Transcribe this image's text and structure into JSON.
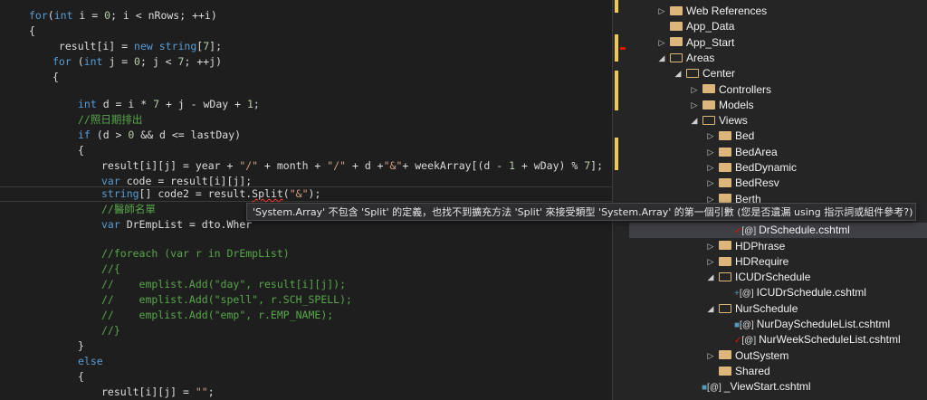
{
  "editor": {
    "lines": [
      {
        "segs": [
          [
            "kw",
            "for"
          ],
          [
            "",
            "("
          ],
          [
            "kw",
            "int"
          ],
          [
            "",
            " i = "
          ],
          [
            "num",
            "0"
          ],
          [
            "",
            "; i < nRows; ++i)"
          ]
        ]
      },
      {
        "segs": [
          [
            "",
            "{"
          ]
        ]
      },
      {
        "segs": [
          [
            "",
            " result[i] = "
          ],
          [
            "kw",
            "new"
          ],
          [
            "",
            " "
          ],
          [
            "kw",
            "string"
          ],
          [
            "",
            "["
          ],
          [
            "num",
            "7"
          ],
          [
            "",
            "];"
          ]
        ]
      },
      {
        "segs": [
          [
            "kw",
            "for"
          ],
          [
            "",
            " ("
          ],
          [
            "kw",
            "int"
          ],
          [
            "",
            " j = "
          ],
          [
            "num",
            "0"
          ],
          [
            "",
            "; j < "
          ],
          [
            "num",
            "7"
          ],
          [
            "",
            "; ++j)"
          ]
        ]
      },
      {
        "segs": [
          [
            "",
            "{"
          ]
        ]
      },
      {
        "segs": []
      },
      {
        "segs": [
          [
            "kw",
            "int"
          ],
          [
            "",
            " d = i * "
          ],
          [
            "num",
            "7"
          ],
          [
            "",
            " + j - wDay + "
          ],
          [
            "num",
            "1"
          ],
          [
            "",
            ";"
          ]
        ]
      },
      {
        "segs": [
          [
            "cm",
            "//照日期排出"
          ]
        ]
      },
      {
        "segs": [
          [
            "kw",
            "if"
          ],
          [
            "",
            " (d > "
          ],
          [
            "num",
            "0"
          ],
          [
            "",
            " && d <= lastDay)"
          ]
        ]
      },
      {
        "segs": [
          [
            "",
            "{"
          ]
        ]
      },
      {
        "segs": [
          [
            "",
            "result[i][j] = year + "
          ],
          [
            "str",
            "\"/\""
          ],
          [
            "",
            " + month + "
          ],
          [
            "str",
            "\"/\""
          ],
          [
            "",
            " + d +"
          ],
          [
            "str",
            "\"&\""
          ],
          [
            "",
            "+ weekArray[(d - "
          ],
          [
            "num",
            "1"
          ],
          [
            "",
            " + wDay) % "
          ],
          [
            "num",
            "7"
          ],
          [
            "",
            "];"
          ]
        ]
      },
      {
        "segs": [
          [
            "kw",
            "var"
          ],
          [
            "",
            " code = result[i][j];"
          ]
        ]
      },
      {
        "segs": [
          [
            "kw",
            "string"
          ],
          [
            "",
            "[] code2 = result."
          ],
          [
            "squig",
            "Split"
          ],
          [
            "",
            "("
          ],
          [
            "str",
            "\"&\""
          ],
          [
            "",
            ");"
          ]
        ]
      },
      {
        "segs": [
          [
            "cm",
            "//醫師名單"
          ]
        ]
      },
      {
        "segs": [
          [
            "kw",
            "var"
          ],
          [
            "",
            " DrEmpList = dto.Wher"
          ]
        ]
      },
      {
        "segs": []
      },
      {
        "segs": [
          [
            "cm",
            "//foreach (var r in DrEmpList)"
          ]
        ]
      },
      {
        "segs": [
          [
            "cm",
            "//{"
          ]
        ]
      },
      {
        "segs": [
          [
            "cm",
            "//    emplist.Add(\"day\", result[i][j]);"
          ]
        ]
      },
      {
        "segs": [
          [
            "cm",
            "//    emplist.Add(\"spell\", r.SCH_SPELL);"
          ]
        ]
      },
      {
        "segs": [
          [
            "cm",
            "//    emplist.Add(\"emp\", r.EMP_NAME);"
          ]
        ]
      },
      {
        "segs": [
          [
            "cm",
            "//}"
          ]
        ]
      },
      {
        "segs": [
          [
            "",
            "}"
          ]
        ]
      },
      {
        "segs": [
          [
            "kw",
            "else"
          ]
        ]
      },
      {
        "segs": [
          [
            "",
            "{"
          ]
        ]
      },
      {
        "segs": [
          [
            "",
            "result[i][j] = "
          ],
          [
            "str",
            "\"\""
          ],
          [
            "",
            ";"
          ]
        ]
      },
      {
        "segs": [
          [
            "",
            "}"
          ]
        ]
      }
    ]
  },
  "tooltip": {
    "text": "'System.Array' 不包含 'Split' 的定義，也找不到擴充方法 'Split' 來接受類型 'System.Array' 的第一個引數 (您是否遺漏 using 指示詞或組件參考?)"
  },
  "explorer": {
    "nodes": [
      {
        "label": "Web References",
        "arrow": "▷",
        "kind": "folder"
      },
      {
        "label": "App_Data",
        "arrow": "",
        "kind": "folder"
      },
      {
        "label": "App_Start",
        "arrow": "▷",
        "kind": "folder"
      },
      {
        "label": "Areas",
        "arrow": "◢",
        "kind": "folder-open"
      },
      {
        "label": "Center",
        "arrow": "◢",
        "kind": "folder-open"
      },
      {
        "label": "Controllers",
        "arrow": "▷",
        "kind": "folder"
      },
      {
        "label": "Models",
        "arrow": "▷",
        "kind": "folder"
      },
      {
        "label": "Views",
        "arrow": "◢",
        "kind": "folder-open"
      },
      {
        "label": "Bed",
        "arrow": "▷",
        "kind": "folder"
      },
      {
        "label": "BedArea",
        "arrow": "▷",
        "kind": "folder"
      },
      {
        "label": "BedDynamic",
        "arrow": "▷",
        "kind": "folder"
      },
      {
        "label": "BedResv",
        "arrow": "▷",
        "kind": "folder"
      },
      {
        "label": "Berth",
        "arrow": "▷",
        "kind": "folder"
      },
      {
        "label": "",
        "arrow": "",
        "kind": "none"
      },
      {
        "label": "DrSchedule.cshtml",
        "arrow": "",
        "kind": "file-red"
      },
      {
        "label": "HDPhrase",
        "arrow": "▷",
        "kind": "folder"
      },
      {
        "label": "HDRequire",
        "arrow": "▷",
        "kind": "folder"
      },
      {
        "label": "ICUDrSchedule",
        "arrow": "◢",
        "kind": "folder-open"
      },
      {
        "label": "ICUDrSchedule.cshtml",
        "arrow": "",
        "kind": "file-add"
      },
      {
        "label": "NurSchedule",
        "arrow": "◢",
        "kind": "folder-open"
      },
      {
        "label": "NurDayScheduleList.cshtml",
        "arrow": "",
        "kind": "file-lock"
      },
      {
        "label": "NurWeekScheduleList.cshtml",
        "arrow": "",
        "kind": "file-red"
      },
      {
        "label": "OutSystem",
        "arrow": "▷",
        "kind": "folder"
      },
      {
        "label": "Shared",
        "arrow": "",
        "kind": "folder"
      },
      {
        "label": "_ViewStart.cshtml",
        "arrow": "",
        "kind": "file-lock"
      }
    ]
  }
}
